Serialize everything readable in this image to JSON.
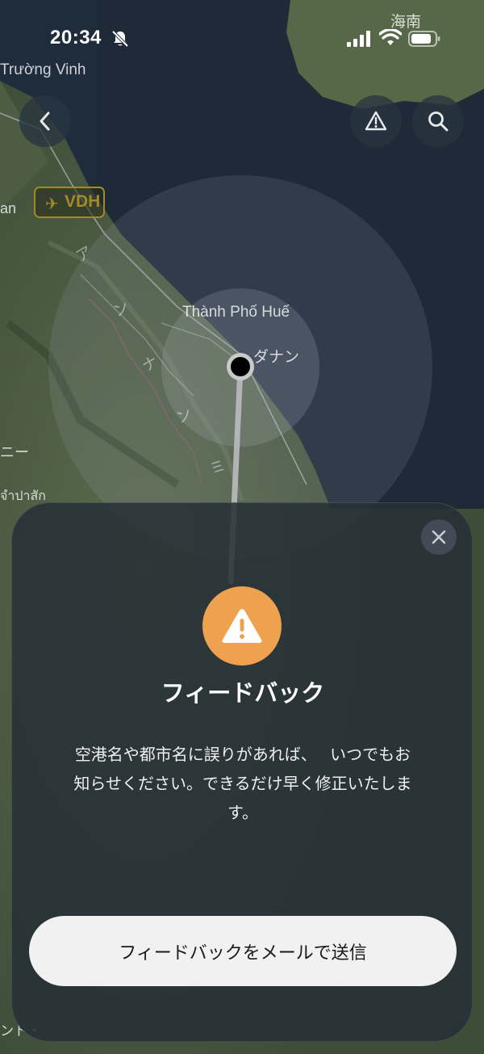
{
  "status_bar": {
    "time": "20:34",
    "icons": [
      "bell-slash-icon",
      "cellular-signal-icon",
      "wifi-icon",
      "battery-icon"
    ]
  },
  "map": {
    "labels": {
      "hainan": "海南",
      "truong_vinh": "Trường Vinh",
      "airport_code": "VDH",
      "hue": "Thành Phố Huế",
      "danang": "ダナン",
      "left_an": "an",
      "left_ni": "ニー",
      "left_thai": "จำปาสัก",
      "laos_1": "ア",
      "laos_2": "ン",
      "laos_3": "ナ",
      "laos_4": "ン",
      "laos_5": "ミ",
      "bottom_left": "ント・"
    },
    "controls": {
      "back": "chevron-left-icon",
      "report": "warning-triangle-icon",
      "search": "search-icon"
    }
  },
  "sheet": {
    "title": "フィードバック",
    "body": "空港名や都市名に誤りがあれば、　 いつでもお知らせください。できるだけ早く修正いたします。",
    "send_button": "フィードバックをメールで送信",
    "icon": "warning-icon",
    "close_icon": "close-icon"
  },
  "colors": {
    "accent_warning": "#eea24f",
    "location_dot": "#000000",
    "sheet_bg": "#262e36",
    "button_bg": "#f1f1f1"
  }
}
